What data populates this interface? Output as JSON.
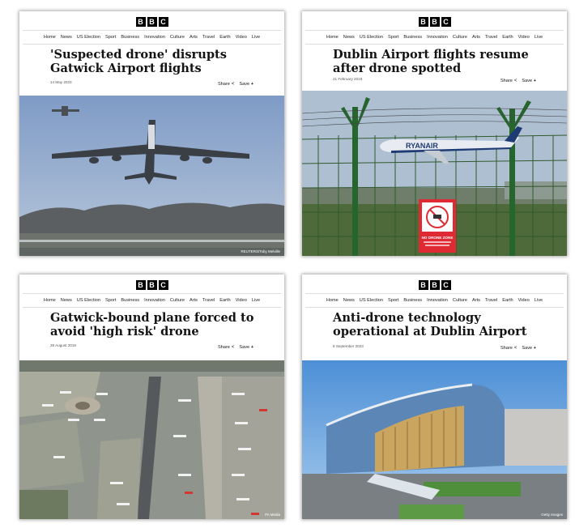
{
  "brand": {
    "letters": [
      "B",
      "B",
      "C"
    ]
  },
  "nav": [
    "Home",
    "News",
    "US Election",
    "Sport",
    "Business",
    "Innovation",
    "Culture",
    "Arts",
    "Travel",
    "Earth",
    "Video",
    "Live"
  ],
  "actions": {
    "share": "Share",
    "save": "Save",
    "save_icon": "+"
  },
  "articles": [
    {
      "headline": "'Suspected drone' disrupts Gatwick Airport flights",
      "date": "14 May 2023",
      "credit": "REUTERS/Toby Melville"
    },
    {
      "headline": "Dublin Airport flights resume after drone spotted",
      "date": "21 February 2019",
      "credit": "",
      "sign_title": "NO DRONE ZONE",
      "airline": "RYANAIR"
    },
    {
      "headline": "Gatwick-bound plane forced to avoid 'high risk' drone",
      "date": "28 August 2019",
      "credit": "PA Media"
    },
    {
      "headline": "Anti-drone technology operational at Dublin Airport",
      "date": "8 September 2023",
      "credit": "Getty Images"
    }
  ]
}
